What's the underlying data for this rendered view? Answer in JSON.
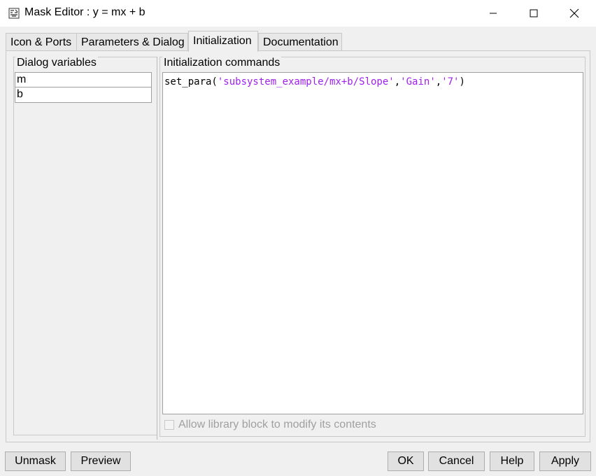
{
  "window": {
    "title": "Mask Editor : y = mx + b",
    "controls": [
      "minimize",
      "maximize",
      "close"
    ]
  },
  "tabs": [
    {
      "label": "Icon & Ports",
      "active": false
    },
    {
      "label": "Parameters & Dialog",
      "active": false
    },
    {
      "label": "Initialization",
      "active": true
    },
    {
      "label": "Documentation",
      "active": false
    }
  ],
  "dialog_variables": {
    "label": "Dialog variables",
    "items": [
      "m",
      "b"
    ]
  },
  "initialization": {
    "label": "Initialization commands",
    "code_prefix": "set_para(",
    "code_arg1": "'subsystem_example/mx+b/Slope'",
    "code_sep1": ",",
    "code_arg2": "'Gain'",
    "code_sep2": ",",
    "code_arg3": "'7'",
    "code_suffix": ")",
    "string_color": "#a020f0"
  },
  "allow_library": {
    "label": "Allow library block to modify its contents",
    "checked": false,
    "enabled": false
  },
  "buttons": {
    "unmask": "Unmask",
    "preview": "Preview",
    "ok": "OK",
    "cancel": "Cancel",
    "help": "Help",
    "apply": "Apply"
  }
}
